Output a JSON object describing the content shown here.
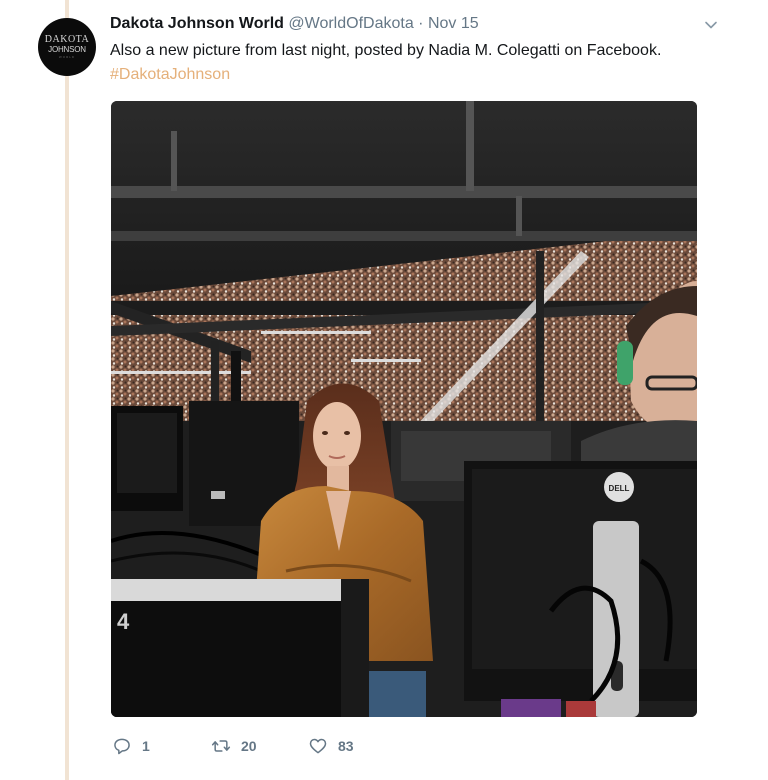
{
  "tweet": {
    "avatar": {
      "line1": "DAKOTA",
      "line2": "JOHNSON",
      "line3": "WORLD"
    },
    "author_name": "Dakota Johnson World",
    "handle": "@WorldOfDakota",
    "separator": "·",
    "date": "Nov 15",
    "text": "Also a new picture from last night, posted by Nadia M. Colegatti on Facebook.",
    "hashtag": "#DakotaJohnson",
    "photo": {
      "description_icon": "photo",
      "monitor_brand": "DELL"
    },
    "actions": {
      "reply_count": "1",
      "retweet_count": "20",
      "like_count": "83"
    }
  },
  "colors": {
    "hashtag": "#e5b07a",
    "thread_line": "#f1e3d3",
    "muted": "#657786"
  }
}
